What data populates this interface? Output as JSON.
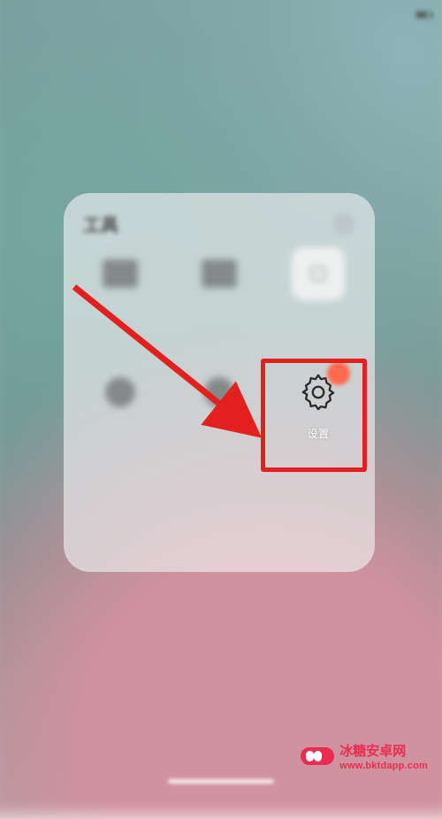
{
  "status": {
    "carrier": "",
    "time": "",
    "right_text": "",
    "battery_pct": 70
  },
  "folder": {
    "title": "工具",
    "items": [
      {
        "label": "",
        "name": "app-1"
      },
      {
        "label": "",
        "name": "app-2"
      },
      {
        "label": "",
        "name": "app-3"
      },
      {
        "label": "",
        "name": "app-4"
      },
      {
        "label": "",
        "name": "app-5"
      },
      {
        "label": "设置",
        "name": "settings"
      }
    ]
  },
  "annotation": {
    "target_label": "设置"
  },
  "watermark": {
    "brand": "冰糖安卓网",
    "url": "www.bktdapp.com"
  }
}
